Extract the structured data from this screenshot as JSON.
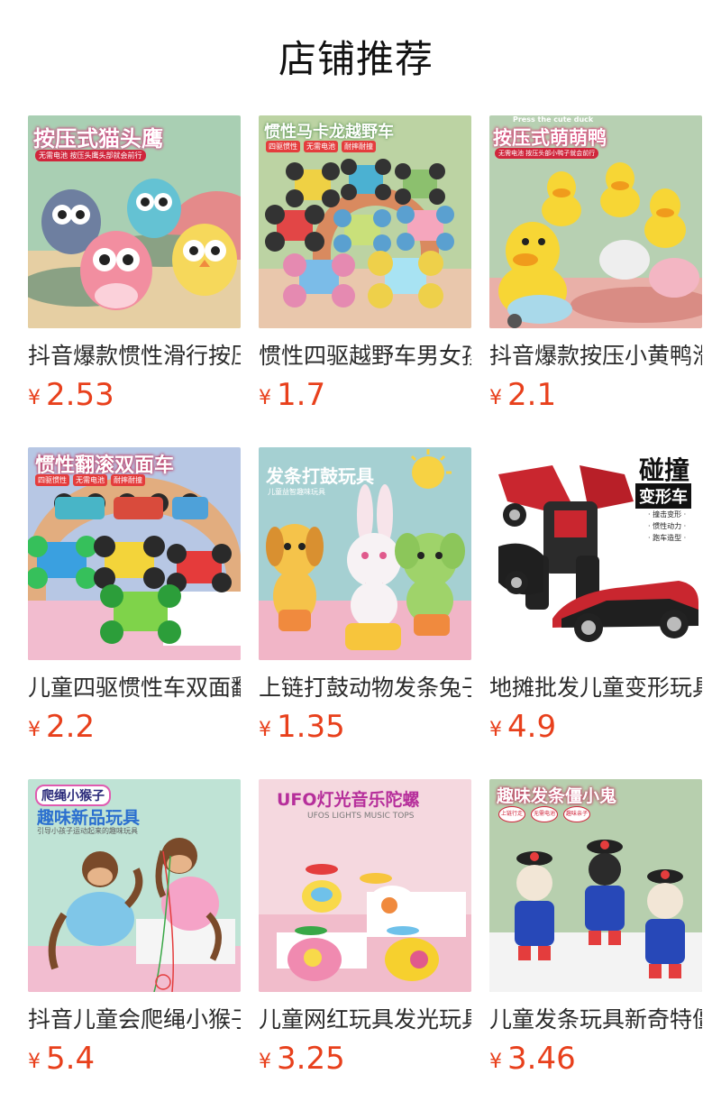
{
  "page": {
    "title": "店铺推荐"
  },
  "currency_symbol": "¥",
  "products": [
    {
      "name": "抖音爆款惯性滑行按压猫头鹰",
      "price": "2.53",
      "image": {
        "icon": "owl-toy-image",
        "headline": "按压式猫头鹰",
        "tags": [
          "无需电池 按压头鹰头部就会前行"
        ]
      }
    },
    {
      "name": "惯性四驱越野车男女孩玩具",
      "price": "1.7",
      "image": {
        "icon": "off-road-car-image",
        "headline": "惯性马卡龙越野车",
        "tags": [
          "四驱惯性",
          "无需电池",
          "耐摔耐撞"
        ]
      }
    },
    {
      "name": "抖音爆款按压小黄鸭滑行车",
      "price": "2.1",
      "image": {
        "icon": "duck-toy-image",
        "headline": "按压式萌萌鸭",
        "sub": "Press the cute duck",
        "tags": [
          "无需电池 按压头部小鸭子就会前行"
        ]
      }
    },
    {
      "name": "儿童四驱惯性车双面翻滚",
      "price": "2.2",
      "image": {
        "icon": "stunt-car-image",
        "headline": "惯性翻滚双面车",
        "tags": [
          "四驱惯性",
          "无需电池",
          "耐摔耐撞"
        ]
      }
    },
    {
      "name": "上链打鼓动物发条兔子玩具",
      "price": "1.35",
      "image": {
        "icon": "drum-animals-image",
        "headline": "发条打鼓玩具",
        "sub": "儿童益智趣味玩具"
      }
    },
    {
      "name": "地摊批发儿童变形玩具车",
      "price": "4.9",
      "image": {
        "icon": "transformer-car-image",
        "headline": "碰撞",
        "badge": "变形车",
        "tags": [
          "· 撞击变形 ·",
          "· 惯性动力 ·",
          "· 跑车造型 ·"
        ]
      }
    },
    {
      "name": "抖音儿童会爬绳小猴子玩具",
      "price": "5.4",
      "image": {
        "icon": "climbing-monkey-image",
        "headline": "趣味新品玩具",
        "badge": "爬绳小猴子",
        "sub": "引导小孩子运动起来的趣味玩具"
      }
    },
    {
      "name": "儿童网红玩具发光玩具陀螺",
      "price": "3.25",
      "image": {
        "icon": "ufo-top-image",
        "headline": "UFO灯光音乐陀螺",
        "sub": "UFOS LIGHTS MUSIC TOPS"
      }
    },
    {
      "name": "儿童发条玩具新奇特僵尸",
      "price": "3.46",
      "image": {
        "icon": "zombie-toy-image",
        "headline": "趣味发条僵小鬼",
        "tags": [
          "上链行走",
          "无需电池",
          "趣味亲子"
        ]
      }
    }
  ]
}
